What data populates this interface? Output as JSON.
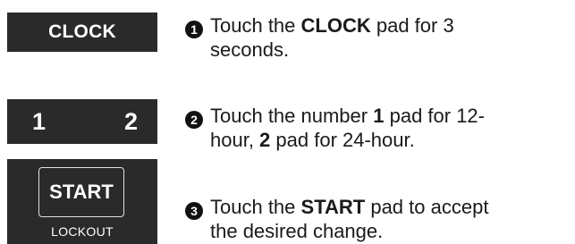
{
  "pads": {
    "clock_label": "CLOCK",
    "number_1": "1",
    "number_2": "2",
    "start_label": "START",
    "lockout_label": "LOCKOUT"
  },
  "steps": [
    {
      "marker": "1",
      "line1_a": "Touch the ",
      "line1_bold": "CLOCK",
      "line1_b": " pad for 3",
      "line2": "seconds."
    },
    {
      "marker": "2",
      "line1_a": "Touch the number ",
      "line1_bold": "1",
      "line1_b": " pad for 12-",
      "line2_a": "hour, ",
      "line2_bold": "2",
      "line2_b": " pad for 24-hour."
    },
    {
      "marker": "3",
      "line1_a": "Touch the ",
      "line1_bold": "START",
      "line1_b": " pad to accept",
      "line2": "the desired change."
    }
  ],
  "colors": {
    "pad_background": "#2a2a2a",
    "pad_text": "#ffffff",
    "body_text": "#1a1a1a",
    "step_marker": "#111111"
  }
}
